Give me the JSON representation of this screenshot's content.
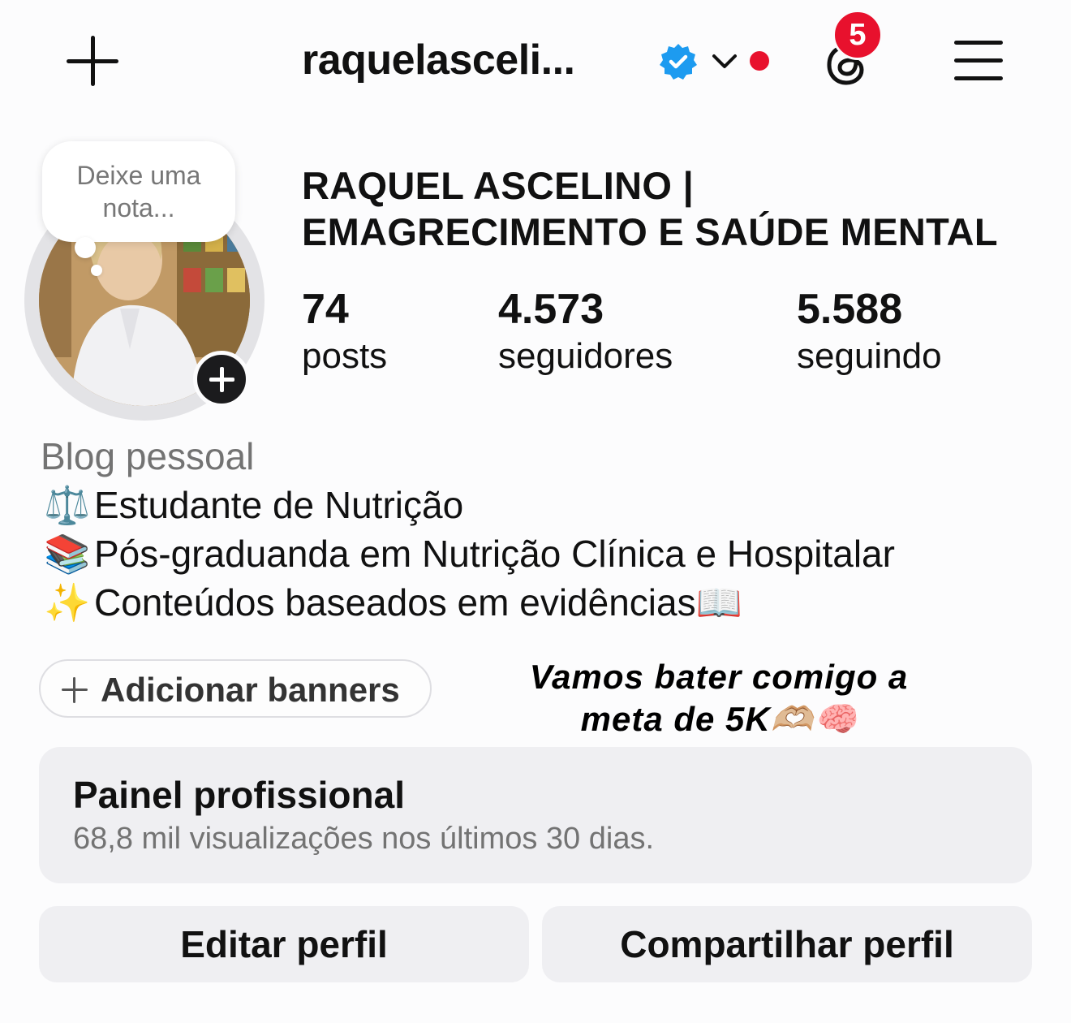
{
  "header": {
    "username": "raquelasceli...",
    "notification_count": "5"
  },
  "note": {
    "placeholder": "Deixe uma nota..."
  },
  "profile": {
    "display_name_line1": "RAQUEL ASCELINO |",
    "display_name_line2": "EMAGRECIMENTO E SAÚDE MENTAL",
    "stats": [
      {
        "value": "74",
        "label": "posts"
      },
      {
        "value": "4.573",
        "label": "seguidores"
      },
      {
        "value": "5.588",
        "label": "seguindo"
      }
    ],
    "category": "Blog pessoal",
    "bio": [
      {
        "emoji": "⚖️",
        "text": "Estudante de Nutrição"
      },
      {
        "emoji": "📚",
        "text": "Pós-graduanda em Nutrição Clínica e Hospitalar"
      },
      {
        "emoji": "✨",
        "text": "Conteúdos baseados em evidências📖"
      }
    ]
  },
  "banners": {
    "label": "Adicionar banners"
  },
  "goal": {
    "line1": "Vamos bater comigo a",
    "line2": "meta de 5K🫶🏼🧠"
  },
  "dashboard": {
    "title": "Painel profissional",
    "subtitle": "68,8 mil visualizações nos últimos 30 dias."
  },
  "actions": {
    "edit": "Editar perfil",
    "share": "Compartilhar perfil"
  },
  "colors": {
    "verified": "#1d9bf0",
    "notification": "#e8112d",
    "button_bg": "#efeff2"
  }
}
